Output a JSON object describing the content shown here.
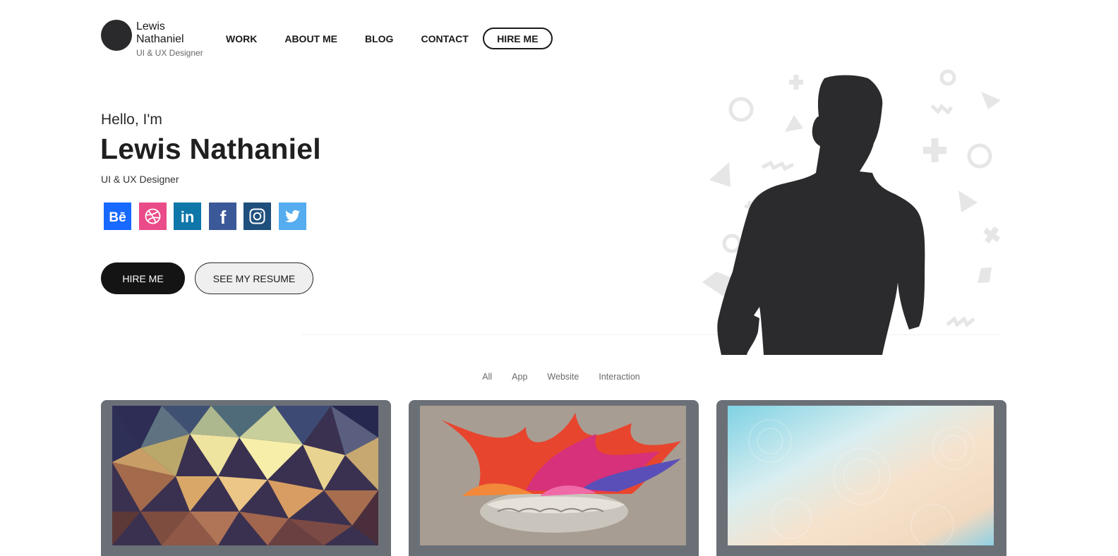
{
  "brand": {
    "name": "Lewis Nathaniel",
    "role": "UI & UX Designer"
  },
  "nav": {
    "items": [
      {
        "label": "WORK"
      },
      {
        "label": "ABOUT ME"
      },
      {
        "label": "BLOG"
      },
      {
        "label": "CONTACT"
      }
    ],
    "hire_label": "HIRE ME"
  },
  "hero": {
    "greeting": "Hello, I'm",
    "name": "Lewis Nathaniel",
    "role": "UI & UX Designer",
    "socials": [
      {
        "icon": "behance-icon",
        "color": "#1769ff"
      },
      {
        "icon": "dribbble-icon",
        "color": "#ea4c89"
      },
      {
        "icon": "linkedin-icon",
        "color": "#0e76a8"
      },
      {
        "icon": "facebook-icon",
        "color": "#3b5998"
      },
      {
        "icon": "instagram-icon",
        "color": "#1f4f7d"
      },
      {
        "icon": "twitter-icon",
        "color": "#55acee"
      }
    ],
    "hire_label": "HIRE ME",
    "resume_label": "SEE MY RESUME"
  },
  "filters": [
    "All",
    "App",
    "Website",
    "Interaction"
  ],
  "portfolio": {
    "card_bg": "#6b7077",
    "cards": [
      {
        "image": "low-poly-abstract"
      },
      {
        "image": "paint-splash-brain"
      },
      {
        "image": "pastel-mandala-gradient"
      }
    ]
  },
  "colors": {
    "primary_dark": "#141414",
    "silhouette": "#2b2b2d",
    "decor_shapes": "#e6e6e6"
  }
}
